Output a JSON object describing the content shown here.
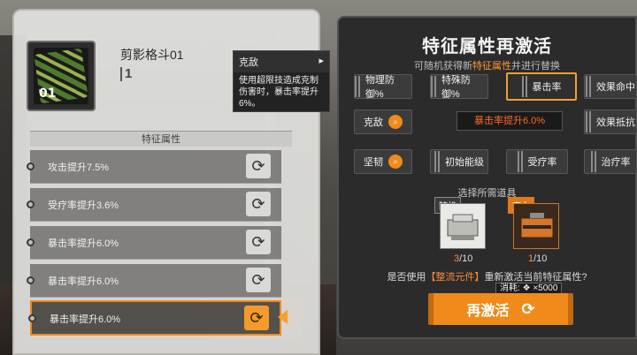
{
  "item": {
    "name": "剪影格斗01",
    "level": "1",
    "card_number": "01"
  },
  "tooltip": {
    "title": "克敌",
    "arrow": "▸",
    "body": "使用超限技造成克制伤害时，暴击率提升6%。"
  },
  "traits": {
    "header": "特征属性",
    "rows": [
      {
        "label": "攻击提升7.5%"
      },
      {
        "label": "受疗率提升3.6%"
      },
      {
        "label": "暴击率提升6.0%"
      },
      {
        "label": "暴击率提升6.0%"
      },
      {
        "label": "暴击率提升6.0%"
      }
    ],
    "selected_index": 4
  },
  "panel": {
    "title": "特征属性再激活",
    "subtitle_prefix": "可随机获得新",
    "subtitle_highlight": "特征属性",
    "subtitle_suffix": "并进行替换",
    "attributes": [
      {
        "label": "物理防御%"
      },
      {
        "label": "特殊防御%"
      },
      {
        "label": "暴击率"
      },
      {
        "label": "效果命中"
      },
      {
        "label": "克敌"
      },
      {
        "label": "效果抵抗"
      },
      {
        "label": "坚韧"
      },
      {
        "label": "初始能级"
      },
      {
        "label": "受疗率"
      },
      {
        "label": "治疗率"
      }
    ],
    "selected_value": "暴击率提升6.0%",
    "items_label": "选择所需道具",
    "items": [
      {
        "tag": "随机",
        "have": "3",
        "need": "/10"
      },
      {
        "tag": "定向",
        "have": "1",
        "need": "/10"
      }
    ],
    "question_prefix": "是否使用",
    "question_highlight": "【整流元件】",
    "question_suffix": "重新激活当前特征属性?",
    "cost_label": "消耗:",
    "cost_value": "×5000",
    "button_label": "再激活"
  },
  "colors": {
    "accent": "#f08a1a",
    "highlight_text": "#ff6a28",
    "panel_bg": "#2b2b2b"
  }
}
